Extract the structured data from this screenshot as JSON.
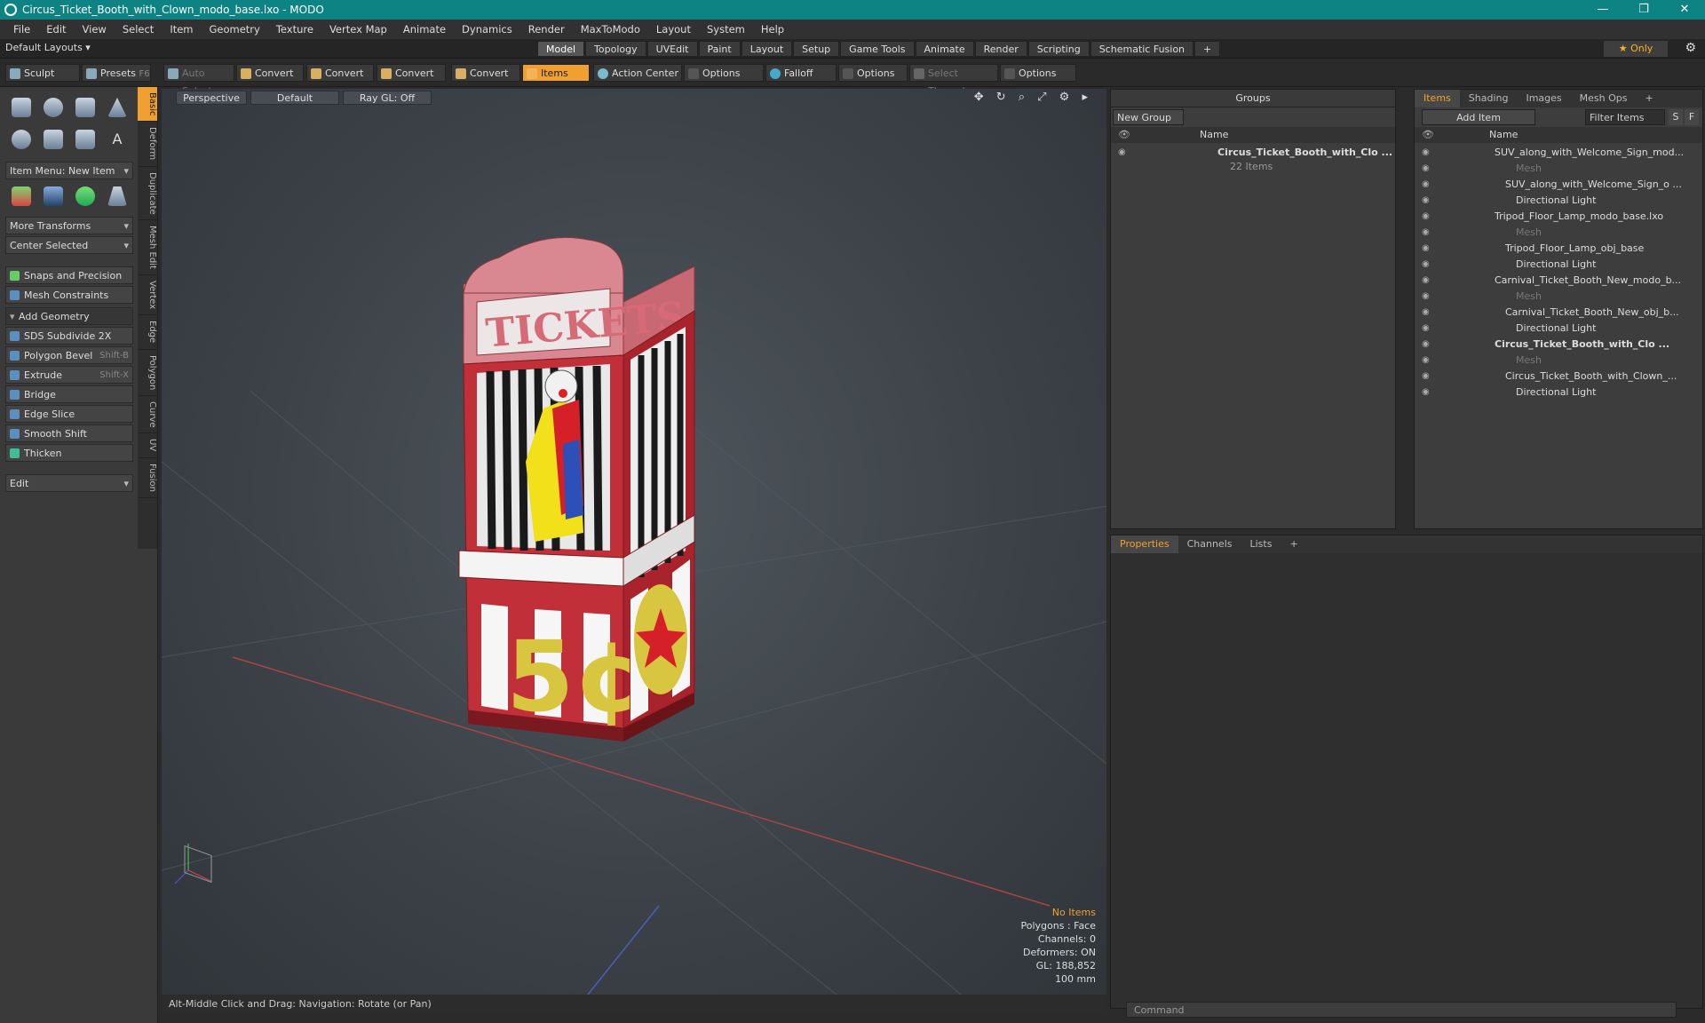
{
  "window": {
    "title": "Circus_Ticket_Booth_with_Clown_modo_base.lxo - MODO",
    "min": "—",
    "max": "❐",
    "close": "✕"
  },
  "menu": [
    "File",
    "Edit",
    "View",
    "Select",
    "Item",
    "Geometry",
    "Texture",
    "Vertex Map",
    "Animate",
    "Dynamics",
    "Render",
    "MaxToModo",
    "Layout",
    "System",
    "Help"
  ],
  "layouts": {
    "label": "Default Layouts ▾",
    "tabs": [
      "Model",
      "Topology",
      "UVEdit",
      "Paint",
      "Layout",
      "Setup",
      "Game Tools",
      "Animate",
      "Render",
      "Scripting",
      "Schematic Fusion",
      "+"
    ],
    "active": "Model",
    "only": "★  Only"
  },
  "toolbar": {
    "sculpt": "Sculpt",
    "presets": "Presets",
    "presets_key": "F6",
    "auto_select": "Auto Select",
    "convert": "Convert",
    "items": "Items",
    "action_center": "Action Center",
    "options": "Options",
    "falloff": "Falloff",
    "select_through": "Select Through"
  },
  "left": {
    "vtabs": [
      "Basic",
      "Deform",
      "Duplicate",
      "Mesh Edit",
      "Vertex",
      "Edge",
      "Polygon",
      "Curve",
      "UV",
      "Fusion"
    ],
    "item_menu": "Item Menu: New Item",
    "more_transforms": "More Transforms",
    "center_selected": "Center Selected",
    "snaps": "Snaps and Precision",
    "mesh_constraints": "Mesh Constraints",
    "add_geometry": "Add Geometry",
    "tools": [
      {
        "label": "SDS Subdivide 2X",
        "key": ""
      },
      {
        "label": "Polygon Bevel",
        "key": "Shift-B"
      },
      {
        "label": "Extrude",
        "key": "Shift-X"
      },
      {
        "label": "Bridge",
        "key": ""
      },
      {
        "label": "Edge Slice",
        "key": ""
      },
      {
        "label": "Smooth Shift",
        "key": ""
      },
      {
        "label": "Thicken",
        "key": ""
      }
    ],
    "edit": "Edit"
  },
  "viewport": {
    "perspective": "Perspective",
    "default": "Default",
    "raygl": "Ray GL: Off",
    "icons": "✥ ↻ ⌕ ⤢ ⚙ ▸",
    "sign": "TICKETS",
    "price": "5¢",
    "info": {
      "no_items": "No Items",
      "polygons": "Polygons : Face",
      "channels": "Channels: 0",
      "deformers": "Deformers: ON",
      "gl": "GL: 188,852",
      "scale": "100 mm"
    }
  },
  "status": {
    "hint": "Alt-Middle Click and Drag:   Navigation: Rotate (or Pan)"
  },
  "groups": {
    "title": "Groups",
    "new_group": "New Group",
    "col_name": "Name",
    "group_name": "Circus_Ticket_Booth_with_Clo ...",
    "group_count": "22 Items"
  },
  "items": {
    "tabs": [
      "Items",
      "Shading",
      "Images",
      "Mesh Ops",
      "+"
    ],
    "add_item": "Add Item",
    "filter": "Filter Items",
    "s": "S",
    "f": "F",
    "col_name": "Name",
    "rows": [
      {
        "label": "SUV_along_with_Welcome_Sign_mod...",
        "indent": 0,
        "dim": false
      },
      {
        "label": "Mesh",
        "indent": 2,
        "dim": true
      },
      {
        "label": "SUV_along_with_Welcome_Sign_o ...",
        "indent": 1,
        "dim": false
      },
      {
        "label": "Directional Light",
        "indent": 2,
        "dim": false
      },
      {
        "label": "Tripod_Floor_Lamp_modo_base.lxo",
        "indent": 0,
        "dim": false
      },
      {
        "label": "Mesh",
        "indent": 2,
        "dim": true
      },
      {
        "label": "Tripod_Floor_Lamp_obj_base",
        "indent": 1,
        "dim": false
      },
      {
        "label": "Directional Light",
        "indent": 2,
        "dim": false
      },
      {
        "label": "Carnival_Ticket_Booth_New_modo_b...",
        "indent": 0,
        "dim": false
      },
      {
        "label": "Mesh",
        "indent": 2,
        "dim": true
      },
      {
        "label": "Carnival_Ticket_Booth_New_obj_b...",
        "indent": 1,
        "dim": false
      },
      {
        "label": "Directional Light",
        "indent": 2,
        "dim": false
      },
      {
        "label": "Circus_Ticket_Booth_with_Clo  ...",
        "indent": 0,
        "dim": false
      },
      {
        "label": "Mesh",
        "indent": 2,
        "dim": true
      },
      {
        "label": "Circus_Ticket_Booth_with_Clown_...",
        "indent": 1,
        "dim": false
      },
      {
        "label": "Directional Light",
        "indent": 2,
        "dim": false
      }
    ]
  },
  "props": {
    "tabs": [
      "Properties",
      "Channels",
      "Lists",
      "+"
    ]
  },
  "command": {
    "placeholder": "Command"
  },
  "colors": {
    "accent": "#f0a030",
    "title": "#0d8483",
    "booth_red": "#b8202a"
  }
}
